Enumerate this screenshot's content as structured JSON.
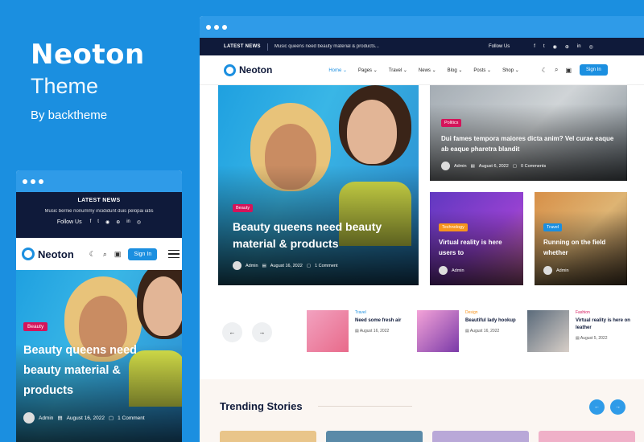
{
  "brand": {
    "name": "Neoton",
    "theme": "Theme",
    "by": "By backtheme"
  },
  "desktop": {
    "topbar": {
      "latest_label": "LATEST NEWS",
      "headline": "Music queens need beauty material & products...",
      "follow_label": "Follow Us"
    },
    "logo": "Neoton",
    "menu": [
      "Home",
      "Pages",
      "Travel",
      "News",
      "Blog",
      "Posts",
      "Shop"
    ],
    "signin": "Sign In",
    "hero": {
      "tag": "Beauty",
      "title": "Beauty queens need beauty material & products",
      "author": "Admin",
      "date": "August 16, 2022",
      "comments": "1 Comment"
    },
    "card1": {
      "tag": "Politics",
      "title": "Dui fames tempora maiores dicta anim? Vel curae eaque ab eaque pharetra blandit",
      "author": "Admin",
      "date": "August 6, 2022",
      "comments": "0 Comments"
    },
    "card2": {
      "tag": "Technology",
      "title": "Virtual reality is here users to",
      "author": "Admin"
    },
    "card3": {
      "tag": "Travel",
      "title": "Running on the field whether",
      "author": "Admin"
    },
    "mini_posts": [
      {
        "cat": "Travel",
        "title": "Need some fresh air",
        "date": "August 16, 2022"
      },
      {
        "cat": "Design",
        "title": "Beautiful lady hookup",
        "date": "August 16, 2022"
      },
      {
        "cat": "Fashion",
        "title": "Virtual reality is here on leather",
        "date": "August 5, 2022"
      }
    ],
    "trending_title": "Trending Stories"
  },
  "mobile": {
    "latest_label": "LATEST NEWS",
    "headline": "Music bernie nonummy incididunt duis pelopai iatis",
    "follow_label": "Follow Us",
    "logo": "Neoton",
    "signin": "Sign In",
    "hero": {
      "tag": "Beauty",
      "title": "Beauty queens need beauty material & products",
      "author": "Admin",
      "date": "August 16, 2022",
      "comments": "1 Comment"
    }
  },
  "colors": {
    "brand_blue": "#1b8fe0",
    "navy": "#0f1a3a",
    "pink": "#d4145a",
    "orange": "#f7941d"
  }
}
